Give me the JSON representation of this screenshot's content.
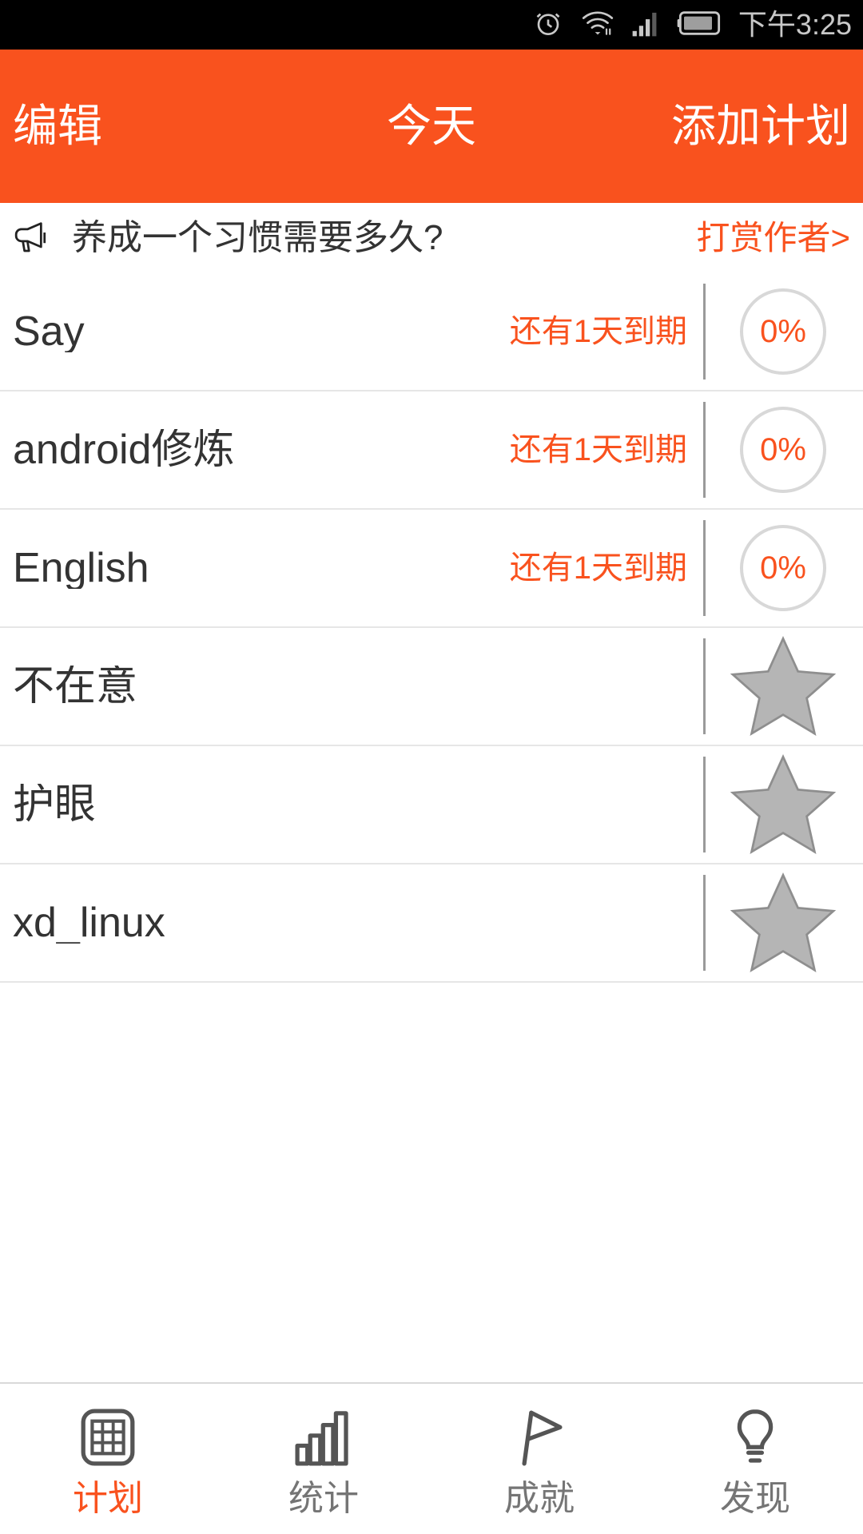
{
  "status_bar": {
    "time": "下午3:25",
    "icons": [
      "alarm-icon",
      "wifi-icon",
      "signal-icon",
      "battery-icon"
    ]
  },
  "app_bar": {
    "left_action": "编辑",
    "title": "今天",
    "right_action": "添加计划",
    "background_color": "#F9521E",
    "text_color": "#FFFFFF"
  },
  "tip_banner": {
    "icon": "megaphone-icon",
    "text": "养成一个习惯需要多久?",
    "link": "打赏作者>",
    "link_color": "#F9521E"
  },
  "plans": [
    {
      "title": "Say",
      "due": "还有1天到期",
      "badge_type": "percent",
      "percent": "0%"
    },
    {
      "title": "android修炼",
      "due": "还有1天到期",
      "badge_type": "percent",
      "percent": "0%"
    },
    {
      "title": "English",
      "due": "还有1天到期",
      "badge_type": "percent",
      "percent": "0%"
    },
    {
      "title": "不在意",
      "due": "",
      "badge_type": "star",
      "percent": ""
    },
    {
      "title": "护眼",
      "due": "",
      "badge_type": "star",
      "percent": ""
    },
    {
      "title": "xd_linux",
      "due": "",
      "badge_type": "star",
      "percent": ""
    }
  ],
  "tab_bar": {
    "active_index": 0,
    "active_color": "#F9521E",
    "inactive_color": "#757575",
    "tabs": [
      {
        "label": "计划",
        "icon": "calendar-icon"
      },
      {
        "label": "统计",
        "icon": "bar-chart-icon"
      },
      {
        "label": "成就",
        "icon": "flag-icon"
      },
      {
        "label": "发现",
        "icon": "lightbulb-icon"
      }
    ]
  }
}
